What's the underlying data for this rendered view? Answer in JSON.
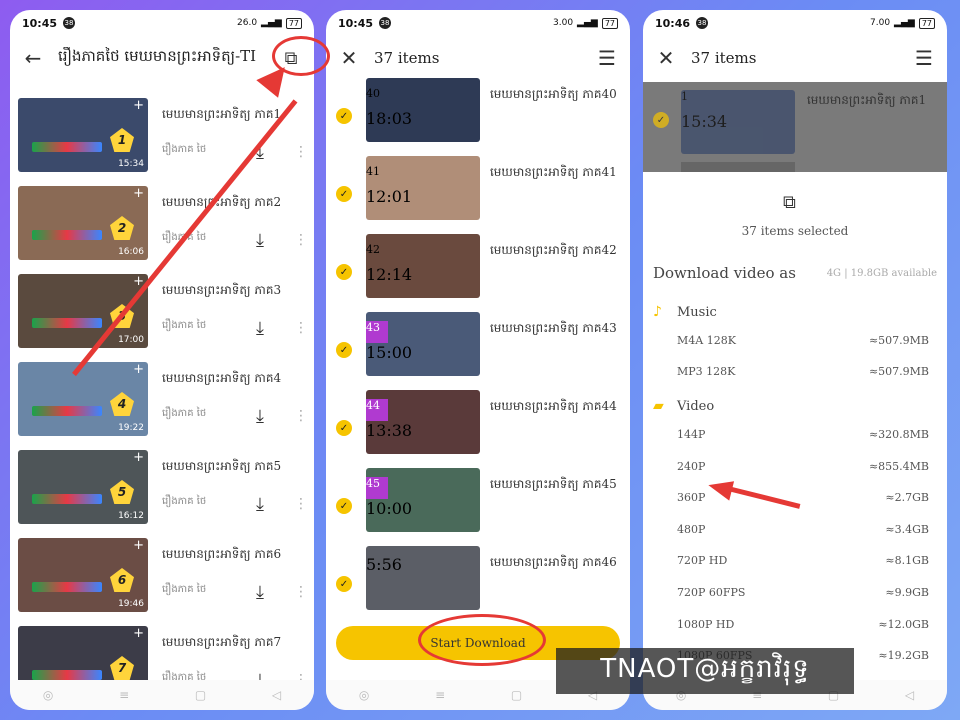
{
  "phone1": {
    "status": {
      "time": "10:45",
      "notif": "38",
      "net": "26.0",
      "battery": "77"
    },
    "title": "រឿងភាគថៃ មេឃមានព្រះអាទិត្យ-TI",
    "back_icon": "←",
    "download_all_icon": "⧉",
    "rows": [
      {
        "title": "មេឃមានព្រះអាទិត្យ ភាគ1",
        "sub": "រឿងភាគ ថៃ",
        "ep": "1",
        "duration": "15:34",
        "color": "#3b4a6b"
      },
      {
        "title": "មេឃមានព្រះអាទិត្យ ភាគ2",
        "sub": "រឿងភាគ ថៃ",
        "ep": "2",
        "duration": "16:06",
        "color": "#8a6a55"
      },
      {
        "title": "មេឃមានព្រះអាទិត្យ ភាគ3",
        "sub": "រឿងភាគ ថៃ",
        "ep": "3",
        "duration": "17:00",
        "color": "#5a4a3e"
      },
      {
        "title": "មេឃមានព្រះអាទិត្យ ភាគ4",
        "sub": "រឿងភាគ ថៃ",
        "ep": "4",
        "duration": "19:22",
        "color": "#6a86a6"
      },
      {
        "title": "មេឃមានព្រះអាទិត្យ ភាគ5",
        "sub": "រឿងភាគ ថៃ",
        "ep": "5",
        "duration": "16:12",
        "color": "#4e5558"
      },
      {
        "title": "មេឃមានព្រះអាទិត្យ ភាគ6",
        "sub": "រឿងភាគ ថៃ",
        "ep": "6",
        "duration": "19:46",
        "color": "#6b4d45"
      },
      {
        "title": "មេឃមានព្រះអាទិត្យ ភាគ7",
        "sub": "រឿងភាគ ថៃ",
        "ep": "7",
        "duration": "",
        "color": "#3c3c48"
      }
    ]
  },
  "phone2": {
    "status": {
      "time": "10:45",
      "notif": "38",
      "net": "3.00",
      "battery": "77"
    },
    "title": "37 items",
    "close_icon": "✕",
    "list_icon": "☰",
    "rows": [
      {
        "title": "មេឃមានព្រះអាទិត្យ ភាគ40",
        "ep": "40",
        "duration": "18:03",
        "color": "#2e3a55"
      },
      {
        "title": "មេឃមានព្រះអាទិត្យ ភាគ41",
        "ep": "41",
        "duration": "12:01",
        "color": "#b08e78"
      },
      {
        "title": "មេឃមានព្រះអាទិត្យ ភាគ42",
        "ep": "42",
        "duration": "12:14",
        "color": "#6a4a3e"
      },
      {
        "title": "មេឃមានព្រះអាទិត្យ ភាគ43",
        "ep": "43",
        "duration": "15:00",
        "color": "#4a5a78"
      },
      {
        "title": "មេឃមានព្រះអាទិត្យ ភាគ44",
        "ep": "44",
        "duration": "13:38",
        "color": "#5a3a3a"
      },
      {
        "title": "មេឃមានព្រះអាទិត្យ ភាគ45",
        "ep": "45",
        "duration": "10:00",
        "color": "#4a6a5a"
      },
      {
        "title": "មេឃមានព្រះអាទិត្យ ភាគ46",
        "ep": "",
        "duration": "5:56",
        "color": "#5b5e66"
      }
    ],
    "start_button": "Start Download"
  },
  "phone3": {
    "status": {
      "time": "10:46",
      "notif": "38",
      "net": "7.00",
      "battery": "77"
    },
    "title": "37 items",
    "dim_row_title": "មេឃមានព្រះអាទិត្យ ភាគ1",
    "dim_row_ep": "1",
    "dim_row_duration": "15:34",
    "selected_text": "37 items selected",
    "header": "Download video as",
    "storage": "4G | 19.8GB available",
    "music_label": "Music",
    "video_label": "Video",
    "music_options": [
      {
        "label": "M4A 128K",
        "size": "≈507.9MB"
      },
      {
        "label": "MP3 128K",
        "size": "≈507.9MB"
      }
    ],
    "video_options": [
      {
        "label": "144P",
        "size": "≈320.8MB"
      },
      {
        "label": "240P",
        "size": "≈855.4MB"
      },
      {
        "label": "360P",
        "size": "≈2.7GB"
      },
      {
        "label": "480P",
        "size": "≈3.4GB"
      },
      {
        "label": "720P HD",
        "size": "≈8.1GB"
      },
      {
        "label": "720P 60FPS",
        "size": "≈9.9GB"
      },
      {
        "label": "1080P HD",
        "size": "≈12.0GB"
      },
      {
        "label": "1080P 60FPS",
        "size": "≈19.2GB"
      }
    ]
  },
  "nav": {
    "back": "◁",
    "home": "▢",
    "menu": "≡",
    "circle": "◎"
  },
  "watermark": "TNAOT@អក្ខរាវិរុទ្ធ",
  "colors": {
    "accent": "#f6c400",
    "annotation": "#e53935"
  }
}
